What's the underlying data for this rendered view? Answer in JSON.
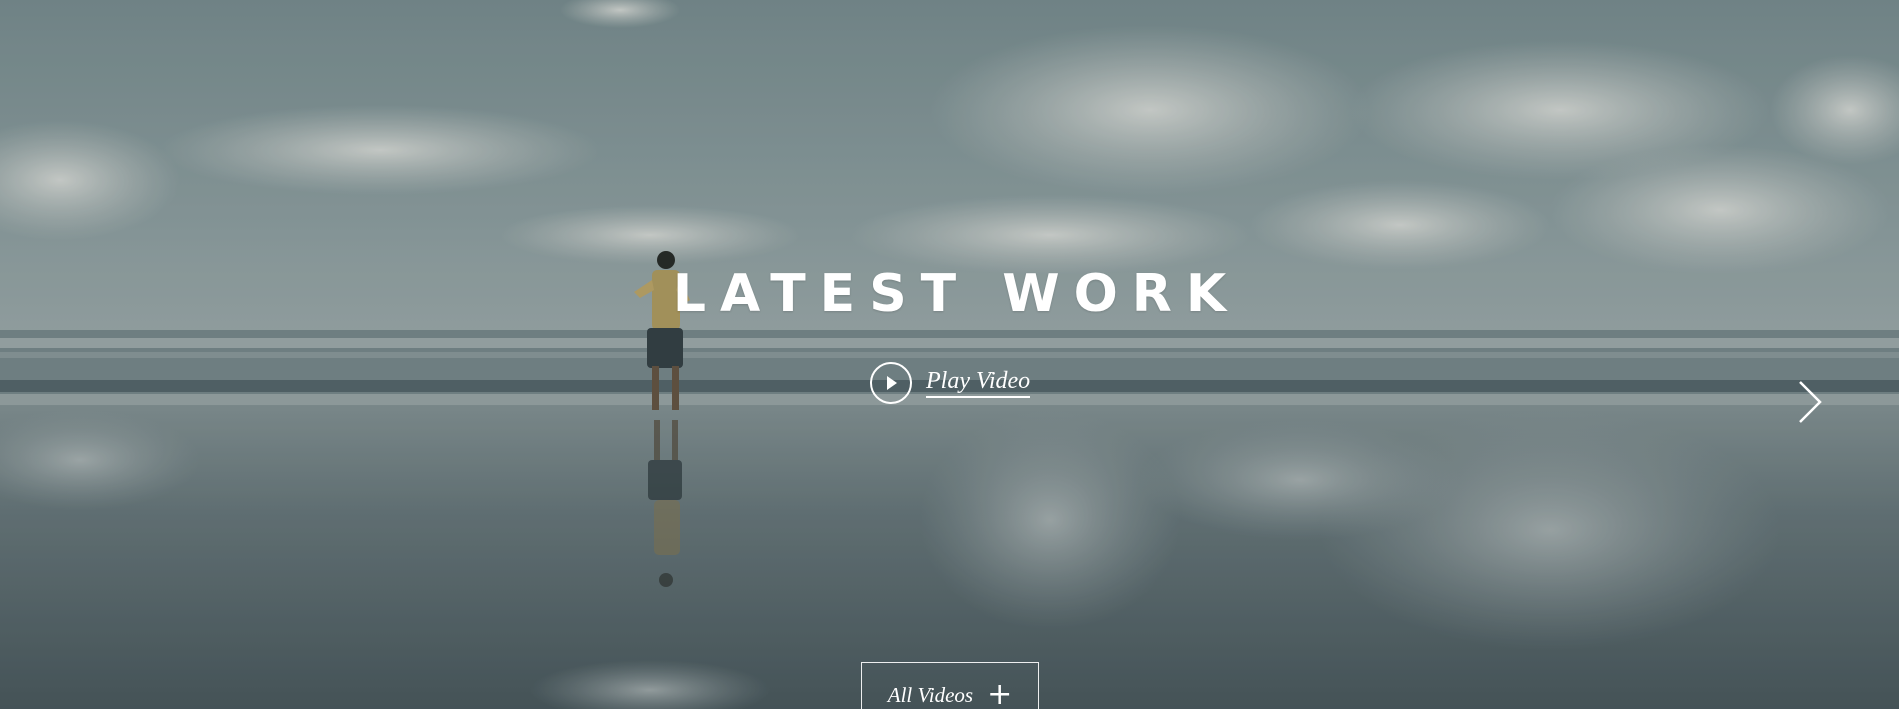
{
  "hero": {
    "title": "LATEST WORK",
    "play_label": "Play Video",
    "play_icon": "play-circle-icon",
    "next_icon": "chevron-right-icon",
    "all_videos_label": "All Videos",
    "all_videos_icon": "plus-icon",
    "plus_glyph": "+"
  },
  "colors": {
    "text": "#ffffff",
    "sky": "#8fa3a6",
    "sea": "#6e8186",
    "sand": "#5f7075"
  }
}
